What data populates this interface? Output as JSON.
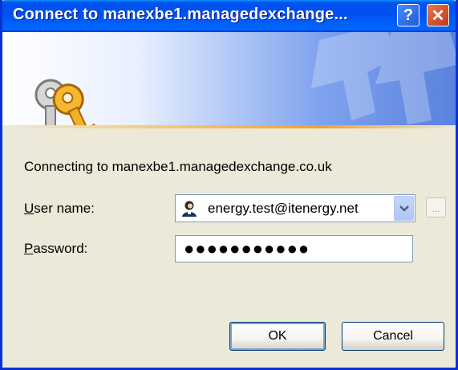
{
  "window": {
    "title": "Connect to manexbe1.managedexchange...",
    "help_label": "?",
    "close_label": "✕"
  },
  "dialog": {
    "connecting_text": "Connecting to manexbe1.managedexchange.co.uk",
    "username_label_accel": "U",
    "username_label_rest": "ser name:",
    "username_value": "energy.test@itenergy.net",
    "password_label_accel": "P",
    "password_label_rest": "assword:",
    "password_mask": "●●●●●●●●●●●",
    "browse_label": "...",
    "ok_label": "OK",
    "cancel_label": "Cancel"
  },
  "icons": {
    "keys": "keys-icon",
    "user": "user-icon",
    "dropdown": "chevron-down-icon"
  },
  "colors": {
    "titlebar": "#0053ee",
    "window_bg": "#ece9d8",
    "input_border": "#7f9db9",
    "close_button": "#c0391b"
  }
}
